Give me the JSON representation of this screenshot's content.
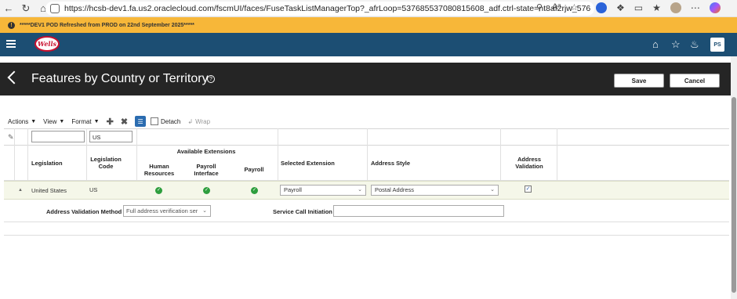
{
  "browser": {
    "url": "https://hcsb-dev1.fa.us2.oraclecloud.com/fscmUI/faces/FuseTaskListManagerTop?_afrLoop=537685537080815608_adf.ctrl-state=nt8af2rjw_576",
    "reader_label": "Aᵃ"
  },
  "announcement": {
    "text": "*****DEV1 POD Refreshed from PROD on 22nd September 2025*****"
  },
  "header": {
    "logo_text": "Wells",
    "avatar_initials": "PS"
  },
  "page": {
    "title": "Features by Country or Territory",
    "save_label": "Save",
    "cancel_label": "Cancel"
  },
  "toolbar": {
    "actions_label": "Actions",
    "view_label": "View",
    "format_label": "Format",
    "detach_label": "Detach",
    "wrap_label": "Wrap"
  },
  "filter": {
    "legislation_value": "",
    "legislation_code_value": "US"
  },
  "table": {
    "headers": {
      "legislation": "Legislation",
      "legislation_code": "Legislation Code",
      "available_extensions": "Available Extensions",
      "human_resources": "Human Resources",
      "payroll_interface": "Payroll Interface",
      "payroll": "Payroll",
      "selected_extension": "Selected Extension",
      "address_style": "Address Style",
      "address_validation": "Address Validation"
    },
    "row": {
      "legislation": "United States",
      "legislation_code": "US",
      "human_resources": true,
      "payroll_interface": true,
      "payroll": true,
      "selected_extension": "Payroll",
      "address_style": "Postal Address",
      "address_validation": true
    }
  },
  "detail": {
    "address_validation_method_label": "Address Validation Method",
    "address_validation_method_value": "Full address verification ser",
    "service_call_initiation_label": "Service Call Initiation",
    "service_call_initiation_value": ""
  }
}
